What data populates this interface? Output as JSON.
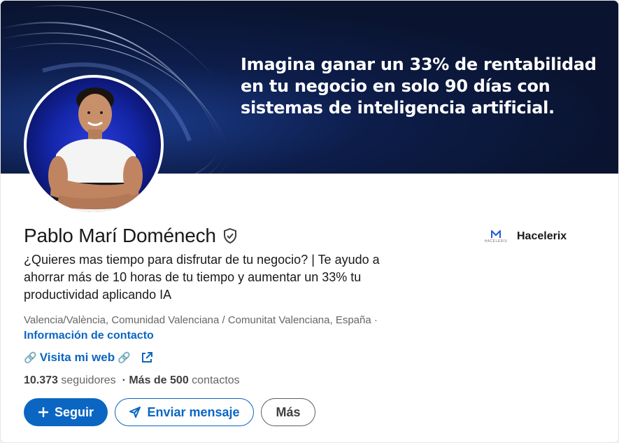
{
  "banner": {
    "text": "Imagina ganar un 33% de rentabilidad en tu negocio en solo 90 días con sistemas de inteligencia artificial."
  },
  "profile": {
    "name": "Pablo Marí Doménech",
    "headline": "¿Quieres mas tiempo para disfrutar de tu negocio? | Te ayudo a ahorrar más de 10 horas de tu tiempo y aumentar un 33% tu productividad aplicando IA",
    "location": "Valencia/València, Comunidad Valenciana / Comunitat Valenciana, España ·",
    "contact_info_label": "Información de contacto",
    "website_label": "Visita mi web",
    "followers_count": "10.373",
    "followers_label": "seguidores",
    "connections_prefix": "· Más de 500",
    "connections_label": "contactos"
  },
  "company": {
    "name": "Hacelerix",
    "logo_text": "HACELERIX"
  },
  "actions": {
    "follow_label": "Seguir",
    "message_label": "Enviar mensaje",
    "more_label": "Más"
  },
  "colors": {
    "accent": "#0a66c2",
    "banner_bg": "#0a1430"
  },
  "icons": [
    "verified-shield-icon",
    "link-icon",
    "external-link-icon",
    "plus-icon",
    "send-icon",
    "company-logo"
  ]
}
